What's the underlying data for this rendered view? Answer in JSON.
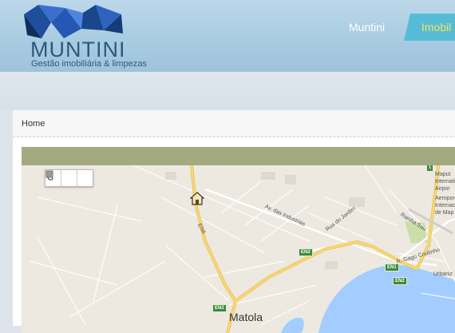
{
  "header": {
    "brand": "MUNTINI",
    "tagline": "Gestão imobiliária & limpezas",
    "nav": [
      {
        "label": "Muntini"
      },
      {
        "label": "Imobil"
      }
    ]
  },
  "breadcrumb": {
    "home": "Home"
  },
  "map": {
    "road_labels": {
      "en4": "EN4",
      "av_industrias": "Av. das Industrias",
      "rua_jardim": "Rua do Jardim",
      "rainha": "Rainha Sau",
      "gago": "R. Gago Coutinho"
    },
    "shields": {
      "en2_top": "EN2",
      "en1": "EN1",
      "en2_right": "EN2",
      "en2_bottom": "EN2",
      "one": "1"
    },
    "places": {
      "maputo": "Maput",
      "internat": "Internati",
      "airport": "Airpor",
      "aeroporto": "Aeroport",
      "internac": "Internac",
      "de_map": "de Map",
      "urbaniz": "Urbaniz",
      "matola_city": "Matola",
      "right_edge": "M"
    },
    "toolbar": [
      "hand-tool",
      "circle-tool",
      "rectangle-tool"
    ],
    "colors": {
      "major_road": "#f4d06a",
      "water": "#a3ccff",
      "land": "#ede9e1",
      "park": "#c9dfaa"
    }
  }
}
